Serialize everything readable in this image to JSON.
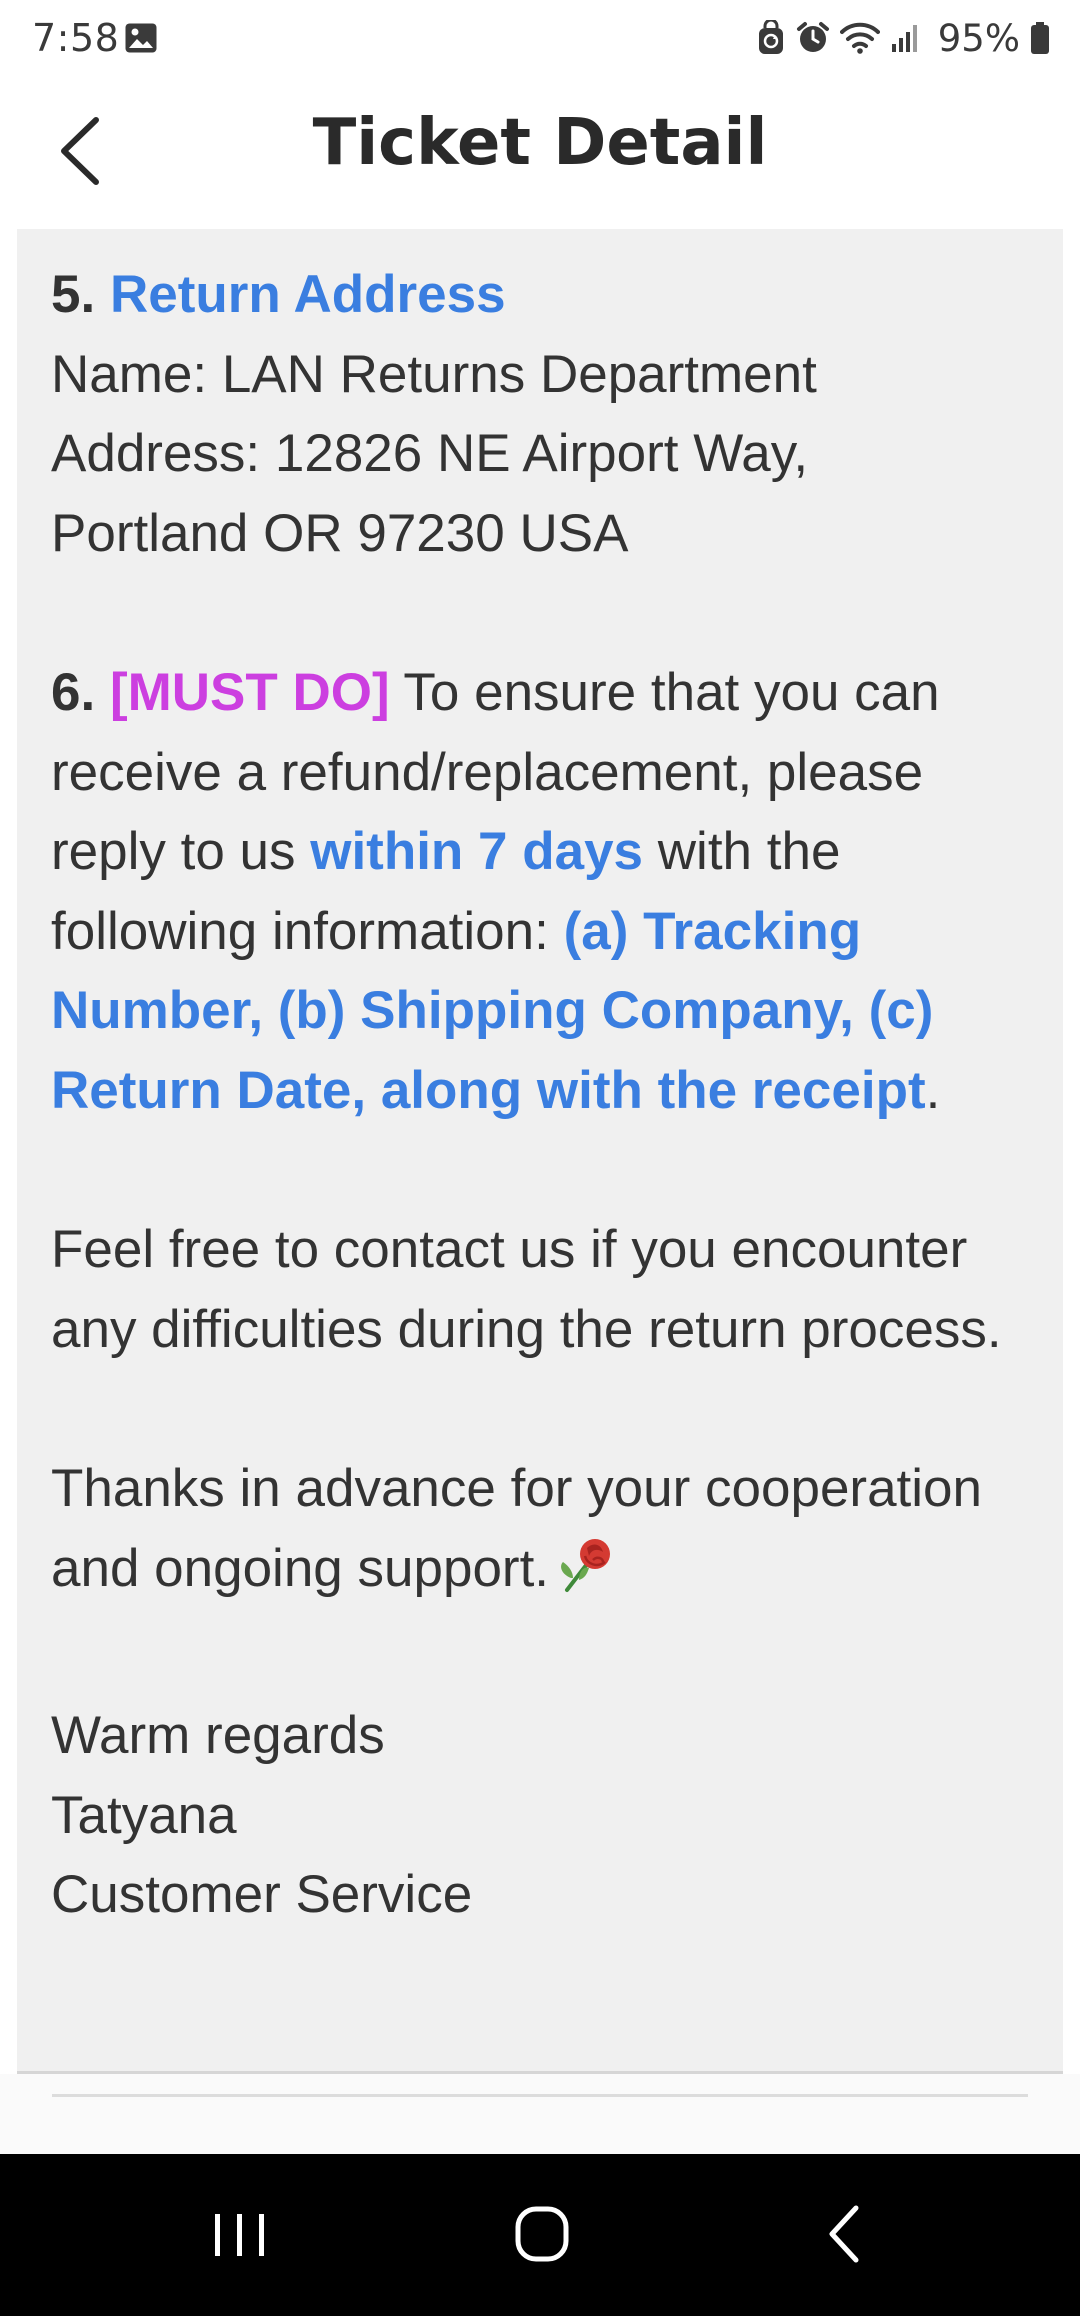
{
  "status_bar": {
    "time": "7:58",
    "battery_percent": "95%",
    "icons": [
      "gallery-icon",
      "sync-lock-icon",
      "alarm-icon",
      "wifi-icon",
      "signal-icon",
      "battery-icon"
    ]
  },
  "header": {
    "title": "Ticket Detail",
    "back_icon": "chevron-left-icon"
  },
  "content": {
    "section5": {
      "number": "5.",
      "heading": "Return Address",
      "name_line": "Name: LAN Returns Department",
      "address_line1": "Address: 12826 NE Airport Way,",
      "address_line2": "Portland OR 97230 USA"
    },
    "section6": {
      "number": "6.",
      "tag": "[MUST DO]",
      "text1": " To ensure that you can receive a refund/replacement, please reply to us ",
      "highlight1": "within 7 days",
      "text2": " with the following information: ",
      "highlight2": "(a) Tracking Number, (b) Shipping Company, (c) Return Date, along with the receipt",
      "text3": "."
    },
    "contact_paragraph": "Feel free to contact us if you encounter any difficulties during the return process.",
    "thanks_paragraph": "Thanks in advance for your cooperation and ongoing support.",
    "thanks_emoji": "rose-icon",
    "signoff": {
      "regards": "Warm regards",
      "name": "Tatyana",
      "role": "Customer Service"
    }
  },
  "colors": {
    "accent_blue": "#3a7ee0",
    "accent_magenta": "#cc3fe0",
    "card_background": "#f0f0f0",
    "nav_bar": "#000000"
  },
  "nav_bar": {
    "buttons": [
      "recents-icon",
      "home-icon",
      "back-icon"
    ]
  }
}
